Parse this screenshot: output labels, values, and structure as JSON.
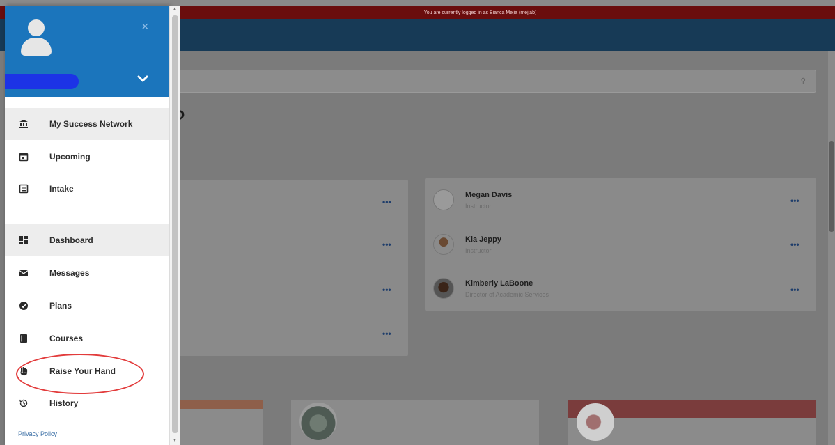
{
  "banner": {
    "text": "You are currently logged in as Bianca Mejia (mejiab)"
  },
  "main": {
    "question_fragment": "o?",
    "left_card_rows": 4,
    "success_network": [
      {
        "name": "Megan Davis",
        "role": "Instructor"
      },
      {
        "name": "Kia Jeppy",
        "role": "Instructor"
      },
      {
        "name": "Kimberly LaBoone",
        "role": "Director of Academic Services"
      }
    ],
    "more_label": "•••"
  },
  "drawer": {
    "close_glyph": "×",
    "menu": [
      {
        "label": "My Success Network",
        "icon": "bank-icon",
        "active": true
      },
      {
        "label": "Upcoming",
        "icon": "calendar-icon",
        "active": false
      },
      {
        "label": "Intake",
        "icon": "list-icon",
        "active": false
      },
      {
        "label": "Dashboard",
        "icon": "dashboard-icon",
        "active": true
      },
      {
        "label": "Messages",
        "icon": "envelope-icon",
        "active": false
      },
      {
        "label": "Plans",
        "icon": "check-circle-icon",
        "active": false
      },
      {
        "label": "Courses",
        "icon": "book-icon",
        "active": false
      },
      {
        "label": "Raise Your Hand",
        "icon": "hand-icon",
        "active": false
      },
      {
        "label": "History",
        "icon": "history-icon",
        "active": false
      }
    ],
    "privacy_label": "Privacy Policy"
  },
  "colors": {
    "drawer_header": "#1b75bc",
    "banner": "#6a0d0d",
    "topbar": "#173a56",
    "highlight": "#e23b3b"
  }
}
